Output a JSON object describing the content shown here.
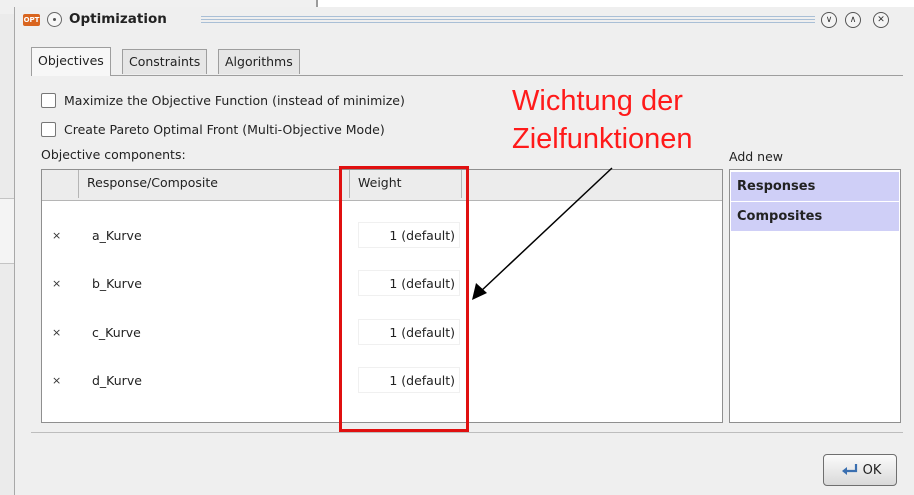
{
  "window": {
    "app_icon": "OPT",
    "title": "Optimization"
  },
  "tabs": [
    {
      "label": "Objectives",
      "active": true
    },
    {
      "label": "Constraints",
      "active": false
    },
    {
      "label": "Algorithms",
      "active": false
    }
  ],
  "options": {
    "maximize_label": "Maximize the Objective Function (instead of minimize)",
    "maximize_checked": false,
    "pareto_label": "Create Pareto Optimal Front (Multi-Objective Mode)",
    "pareto_checked": false
  },
  "objective_components": {
    "label": "Objective components:",
    "columns": [
      "",
      "Response/Composite",
      "Weight"
    ],
    "rows": [
      {
        "delete": "×",
        "name": "a_Kurve",
        "weight": "1 (default)"
      },
      {
        "delete": "×",
        "name": "b_Kurve",
        "weight": "1 (default)"
      },
      {
        "delete": "×",
        "name": "c_Kurve",
        "weight": "1 (default)"
      },
      {
        "delete": "×",
        "name": "d_Kurve",
        "weight": "1 (default)"
      }
    ]
  },
  "add_new": {
    "label": "Add new",
    "items": [
      "Responses",
      "Composites"
    ]
  },
  "footer": {
    "ok_label": "OK"
  },
  "annotation": {
    "line1": "Wichtung der",
    "line2": "Zielfunktionen",
    "color": "#ff1a1a"
  },
  "colors": {
    "list_highlight": "#cfcff7",
    "annotation_red": "#e01010"
  }
}
